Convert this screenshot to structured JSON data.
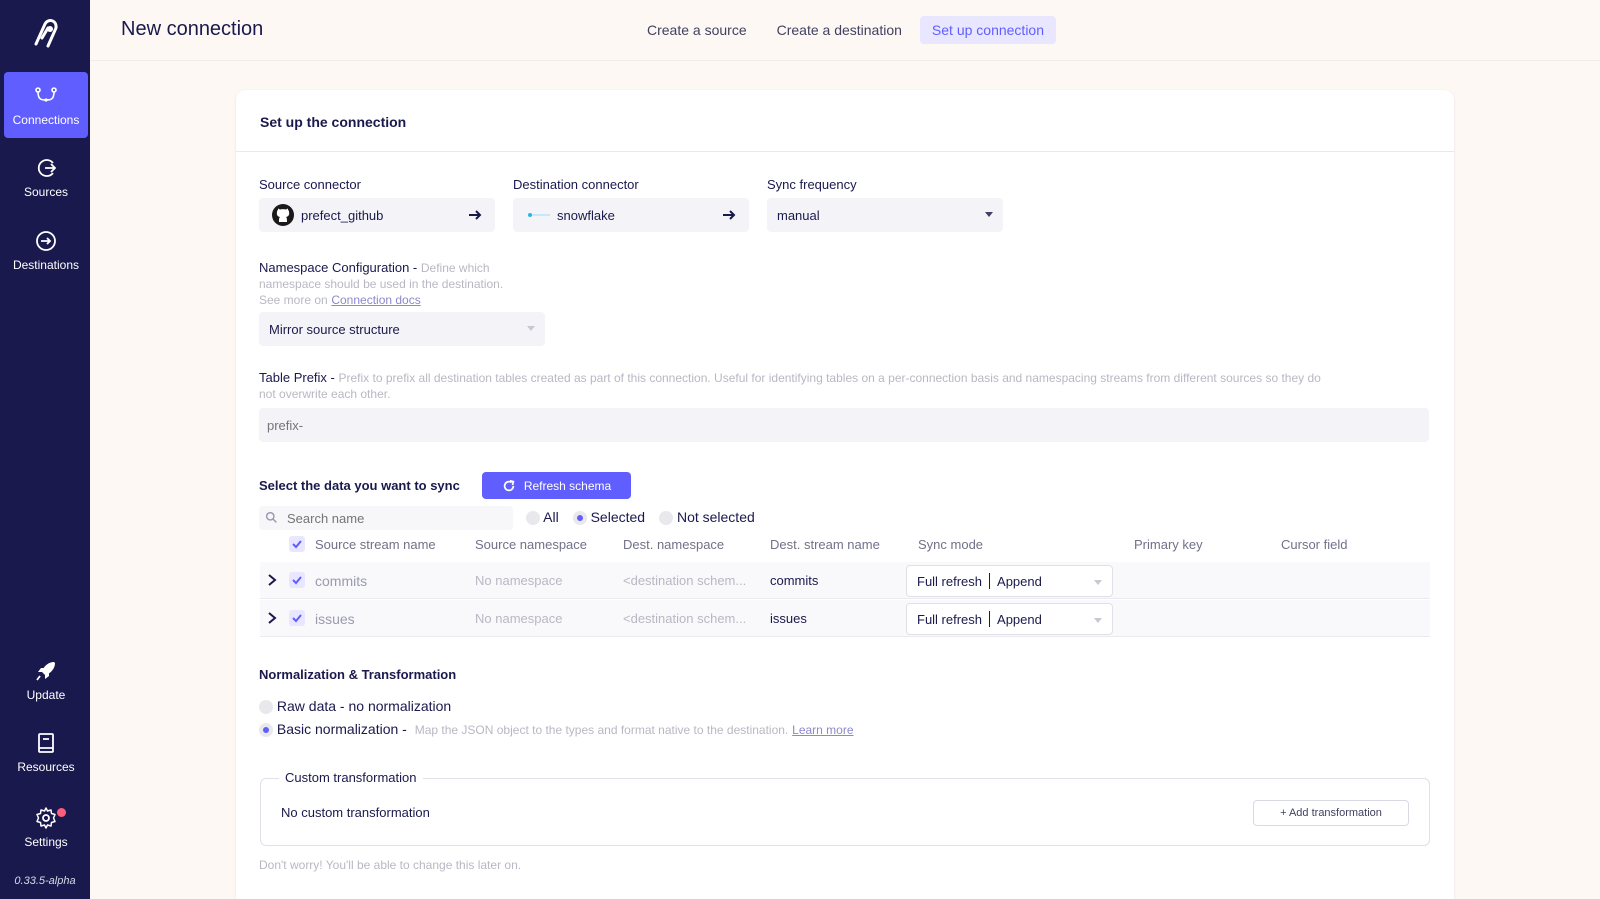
{
  "sidebar": {
    "items": [
      {
        "label": "Connections",
        "icon": "connections-icon"
      },
      {
        "label": "Sources",
        "icon": "sources-icon"
      },
      {
        "label": "Destinations",
        "icon": "destinations-icon"
      }
    ],
    "bottom": [
      {
        "label": "Update",
        "icon": "rocket-icon"
      },
      {
        "label": "Resources",
        "icon": "book-icon"
      },
      {
        "label": "Settings",
        "icon": "gear-icon"
      }
    ],
    "version": "0.33.5-alpha"
  },
  "header": {
    "title": "New connection",
    "steps": [
      "Create a source",
      "Create a destination",
      "Set up connection"
    ]
  },
  "card": {
    "title": "Set up the connection",
    "source": {
      "label": "Source connector",
      "value": "prefect_github"
    },
    "destination": {
      "label": "Destination connector",
      "value": "snowflake"
    },
    "frequency": {
      "label": "Sync frequency",
      "value": "manual"
    },
    "namespace": {
      "label": "Namespace Configuration -",
      "hint1": "Define which",
      "hint2": "namespace should be used in the destination.",
      "hint3": "See more on",
      "link": "Connection docs",
      "value": "Mirror source structure"
    },
    "prefix": {
      "label": "Table Prefix -",
      "hint": "Prefix to prefix all destination tables created as part of this connection. Useful for identifying tables on a per-connection basis and namespacing streams from different sources so they do",
      "hint2": "not overwrite each other.",
      "placeholder": "prefix-"
    },
    "sync": {
      "label": "Select the data you want to sync",
      "refresh": "Refresh schema",
      "search_placeholder": "Search name",
      "filters": [
        "All",
        "Selected",
        "Not selected"
      ],
      "selected_filter": "Selected",
      "columns": [
        "Source stream name",
        "Source namespace",
        "Dest. namespace",
        "Dest. stream name",
        "Sync mode",
        "Primary key",
        "Cursor field"
      ],
      "rows": [
        {
          "name": "commits",
          "src_ns": "No namespace",
          "dest_ns": "<destination schem...",
          "dest_name": "commits",
          "mode_a": "Full refresh",
          "mode_b": "Append"
        },
        {
          "name": "issues",
          "src_ns": "No namespace",
          "dest_ns": "<destination schem...",
          "dest_name": "issues",
          "mode_a": "Full refresh",
          "mode_b": "Append"
        }
      ]
    },
    "normalization": {
      "label": "Normalization & Transformation",
      "raw": "Raw data - no normalization",
      "basic": "Basic normalization -",
      "basic_hint": "Map the JSON object to the types and format native to the destination.",
      "learn_more": "Learn more",
      "selected": "basic"
    },
    "custom": {
      "legend": "Custom transformation",
      "empty": "No custom transformation",
      "add": "+ Add transformation",
      "footer": "Don't worry! You'll be able to change this later on."
    }
  },
  "colors": {
    "sidebar": "#1a194d",
    "accent": "#615eff",
    "background": "#fdf8f3"
  }
}
